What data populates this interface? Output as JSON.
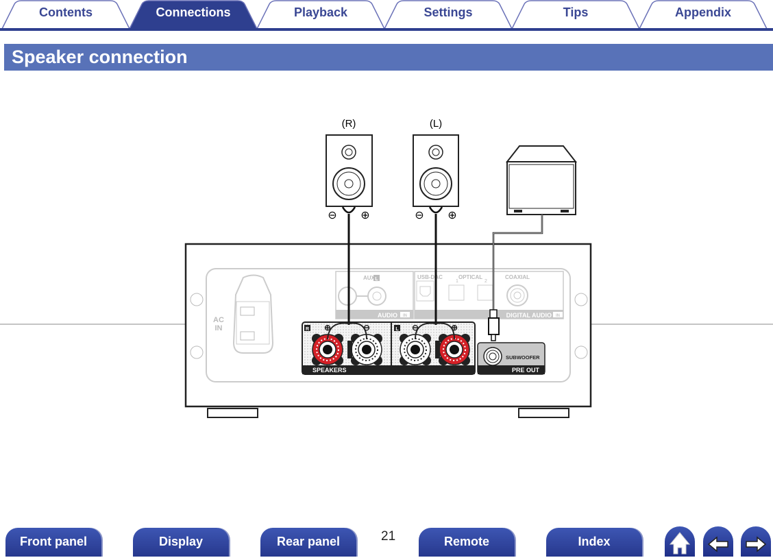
{
  "tabs": [
    {
      "label": "Contents",
      "active": false
    },
    {
      "label": "Connections",
      "active": true
    },
    {
      "label": "Playback",
      "active": false
    },
    {
      "label": "Settings",
      "active": false
    },
    {
      "label": "Tips",
      "active": false
    },
    {
      "label": "Appendix",
      "active": false
    }
  ],
  "header": {
    "title": "Speaker connection"
  },
  "diagram": {
    "speaker_right": "(R)",
    "speaker_left": "(L)",
    "ac_in_1": "AC",
    "ac_in_2": "IN",
    "aux": "AUX",
    "aux_l": "L",
    "audio_in": "AUDIO",
    "in_badge": "IN",
    "usb_dac": "USB-DAC",
    "optical": "OPTICAL",
    "optical_1": "1",
    "optical_2": "2",
    "coaxial": "COAXIAL",
    "digital_audio_in": "DIGITAL AUDIO",
    "r_badge": "R",
    "l_badge": "L",
    "speakers": "SPEAKERS",
    "subwoofer": "SUBWOOFER",
    "pre_out": "PRE OUT",
    "colors": {
      "positive_terminal": "#d42027",
      "tab_active": "#2e3f8f",
      "header_bar": "#5872b8"
    }
  },
  "footer": {
    "buttons": [
      "Front panel",
      "Display",
      "Rear panel",
      "Remote",
      "Index"
    ],
    "page_number": "21",
    "icons": [
      "home-icon",
      "back-arrow-icon",
      "forward-arrow-icon"
    ]
  }
}
